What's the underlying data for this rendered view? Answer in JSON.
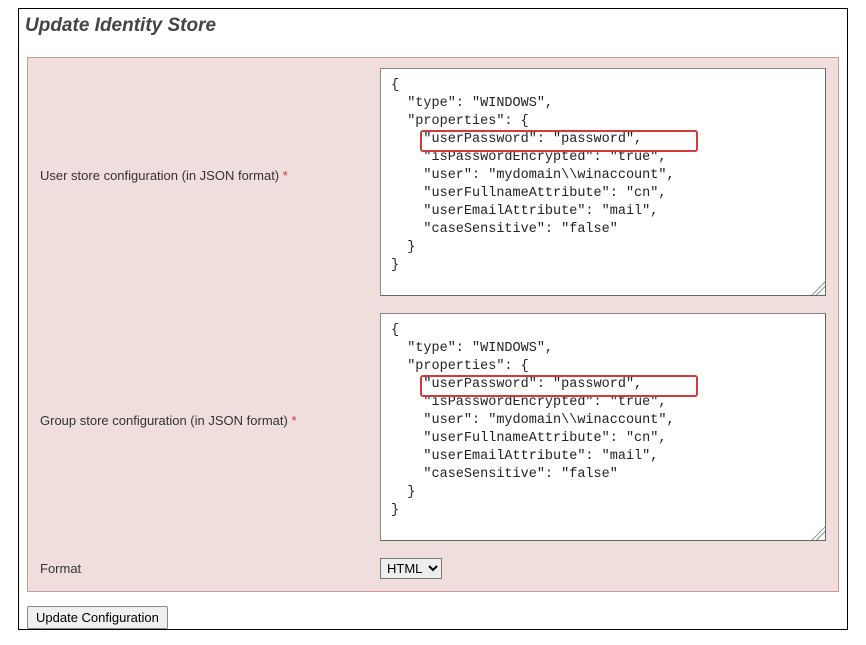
{
  "page_title": "Update Identity Store",
  "fields": {
    "user_store": {
      "label": "User store configuration (in JSON format)",
      "required_mark": "*",
      "value": "{\n  \"type\": \"WINDOWS\",\n  \"properties\": {\n    \"userPassword\": \"password\",\n    \"isPasswordEncrypted\": \"true\",\n    \"user\": \"mydomain\\\\winaccount\",\n    \"userFullnameAttribute\": \"cn\",\n    \"userEmailAttribute\": \"mail\",\n    \"caseSensitive\": \"false\"\n  }\n}"
    },
    "group_store": {
      "label": "Group store configuration (in JSON format)",
      "required_mark": "*",
      "value": "{\n  \"type\": \"WINDOWS\",\n  \"properties\": {\n    \"userPassword\": \"password\",\n    \"isPasswordEncrypted\": \"true\",\n    \"user\": \"mydomain\\\\winaccount\",\n    \"userFullnameAttribute\": \"cn\",\n    \"userEmailAttribute\": \"mail\",\n    \"caseSensitive\": \"false\"\n  }\n}"
    },
    "format": {
      "label": "Format",
      "selected": "HTML",
      "options": [
        "HTML"
      ]
    }
  },
  "actions": {
    "update": "Update Configuration"
  },
  "highlights": {
    "user_store_line": "\"isPasswordEncrypted\": \"true\",",
    "group_store_line": "\"isPasswordEncrypted\": \"true\","
  }
}
